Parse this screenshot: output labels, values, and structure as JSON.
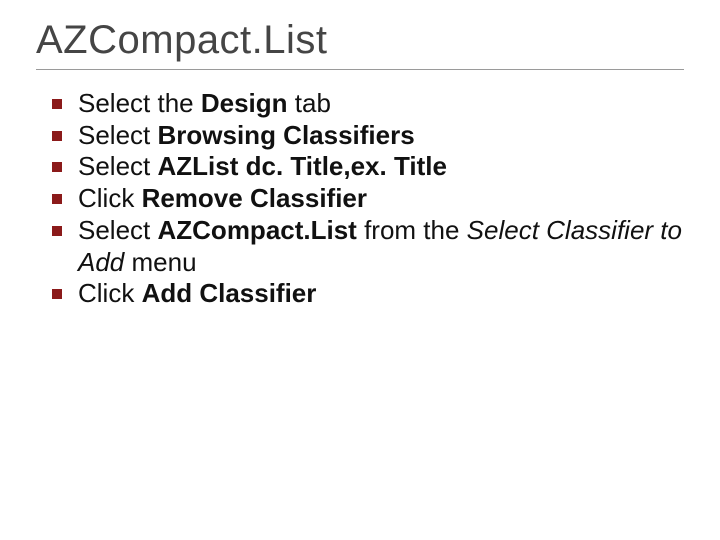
{
  "title": "AZCompact.List",
  "items": [
    {
      "runs": [
        {
          "t": "Select the "
        },
        {
          "t": "Design",
          "b": true
        },
        {
          "t": " tab"
        }
      ]
    },
    {
      "runs": [
        {
          "t": "Select "
        },
        {
          "t": "Browsing Classifiers",
          "b": true
        }
      ]
    },
    {
      "runs": [
        {
          "t": "Select "
        },
        {
          "t": "AZList dc. Title,ex. Title",
          "b": true
        }
      ]
    },
    {
      "runs": [
        {
          "t": "Click "
        },
        {
          "t": "Remove Classifier",
          "b": true
        }
      ]
    },
    {
      "runs": [
        {
          "t": "Select "
        },
        {
          "t": "AZCompact.List",
          "b": true
        },
        {
          "t": " from the "
        },
        {
          "t": "Select Classifier to Add",
          "i": true
        },
        {
          "t": " menu"
        }
      ]
    },
    {
      "runs": [
        {
          "t": "Click "
        },
        {
          "t": "Add Classifier",
          "b": true
        }
      ]
    }
  ]
}
